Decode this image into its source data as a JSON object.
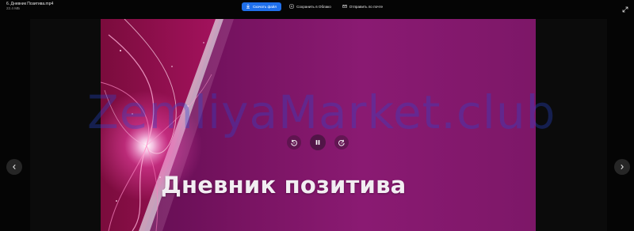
{
  "file": {
    "name": "6. Дневник Позитива.mp4",
    "size": "22.4 MБ"
  },
  "toolbar": {
    "download_label": "Скачать файл",
    "save_cloud_label": "Сохранить в Облако",
    "send_email_label": "Отправить по почте"
  },
  "video": {
    "title": "Дневник позитива",
    "state": "playing"
  },
  "watermark": {
    "text": "ZemliyaMarket.club"
  },
  "colors": {
    "accent": "#1f6feb",
    "background": "#050505",
    "video_purple": "#7a1463"
  },
  "icons": {
    "download": "download-icon",
    "cloud": "cloud-save-icon",
    "email": "mail-icon",
    "expand": "expand-icon",
    "rewind": "rewind-10-icon",
    "pause": "pause-icon",
    "forward": "forward-10-icon",
    "prev": "chevron-left-icon",
    "next": "chevron-right-icon"
  }
}
